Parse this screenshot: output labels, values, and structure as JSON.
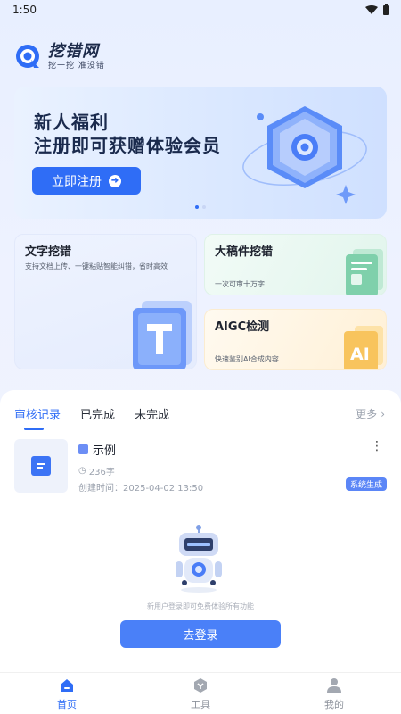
{
  "status_bar": {
    "time": "1:50"
  },
  "brand": {
    "name": "挖错网",
    "slogan": "挖一挖 准没错"
  },
  "banner": {
    "line1": "新人福利",
    "line2": "注册即可获赠体验会员",
    "button_label": "立即注册"
  },
  "features": {
    "text_check": {
      "title": "文字挖错",
      "desc": "支持文档上传、一键粘贴智能纠错，省时高效"
    },
    "big_doc": {
      "title": "大稿件挖错",
      "desc": "一次可审十万字"
    },
    "aigc": {
      "title": "AIGC检测",
      "desc": "快速鉴别AI合成内容"
    }
  },
  "records": {
    "tabs": [
      {
        "label": "审核记录"
      },
      {
        "label": "已完成"
      },
      {
        "label": "未完成"
      }
    ],
    "more_label": "更多",
    "item": {
      "title": "示例",
      "word_count": "236字",
      "created": "创建时间：2025-04-02 13:50",
      "badge": "系统生成"
    },
    "empty_text": "新用户登录即可免费体验所有功能",
    "login_button": "去登录"
  },
  "bottom_nav": [
    {
      "label": "首页",
      "icon": "home-icon"
    },
    {
      "label": "工具",
      "icon": "tools-icon"
    },
    {
      "label": "我的",
      "icon": "user-icon"
    }
  ],
  "colors": {
    "primary": "#2f6df6",
    "badge": "#5b86f7"
  }
}
